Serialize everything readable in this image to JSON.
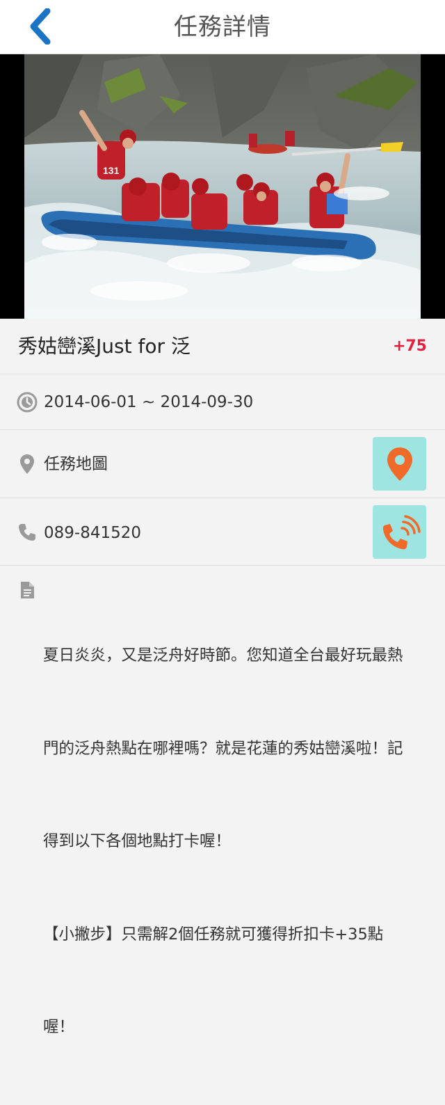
{
  "header": {
    "title": "任務詳情",
    "back_icon": "chevron-left-icon"
  },
  "hero": {
    "alt": "秀姑巒溪泛舟",
    "helmet_number": "131"
  },
  "task": {
    "name": "秀姑巒溪Just for 泛",
    "points": "+75"
  },
  "date": {
    "icon": "clock-icon",
    "range": "2014-06-01 ~ 2014-09-30"
  },
  "map": {
    "icon": "map-pin-icon",
    "label": "任務地圖",
    "button_icon": "location-marker-icon"
  },
  "phone": {
    "icon": "phone-icon",
    "number": "089-841520",
    "button_icon": "call-ringing-icon"
  },
  "description": {
    "icon": "document-icon",
    "lines": [
      "夏日炎炎，又是泛舟好時節。您知道全台最好玩最熱",
      "門的泛舟熱點在哪裡嗎？就是花蓮的秀姑巒溪啦！記",
      "得到以下各個地點打卡喔！",
      "【小撇步】只需解2個任務就可獲得折扣卡+35點",
      "喔！"
    ]
  },
  "colors": {
    "accent_blue": "#1a73c4",
    "points_red": "#e4203e",
    "button_bg": "#9ee5e2",
    "button_orange": "#f06a2a"
  }
}
